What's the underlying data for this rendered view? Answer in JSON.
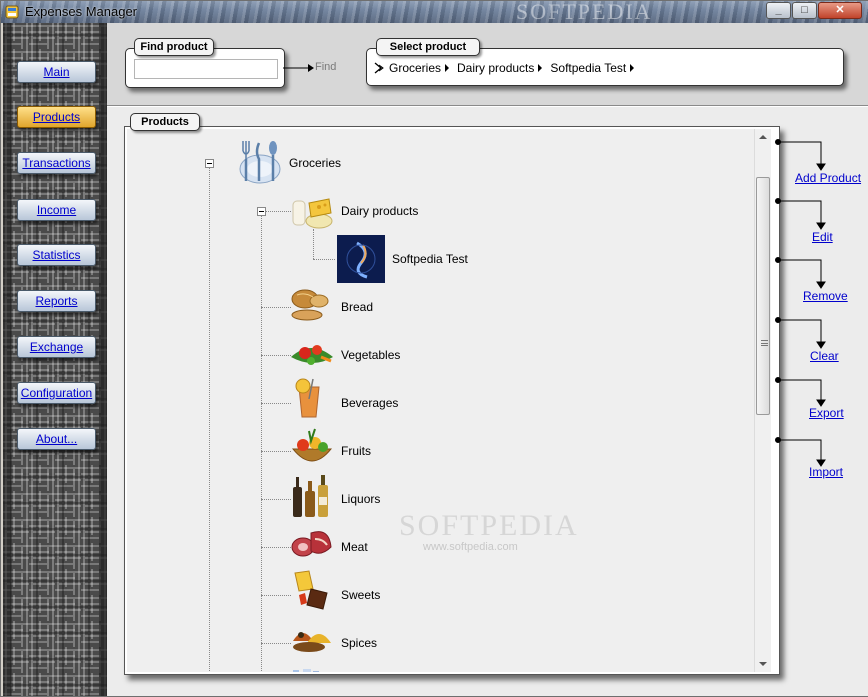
{
  "window": {
    "title": "Expenses Manager",
    "watermark": "SOFTPEDIA",
    "controls": {
      "minimize": "_",
      "maximize": "□",
      "close": "✕"
    }
  },
  "nav": {
    "items": [
      {
        "label": "Main",
        "active": false
      },
      {
        "label": "Products",
        "active": true
      },
      {
        "label": "Transactions",
        "active": false
      },
      {
        "label": "Income",
        "active": false
      },
      {
        "label": "Statistics",
        "active": false
      },
      {
        "label": "Reports",
        "active": false
      },
      {
        "label": "Exchange",
        "active": false
      },
      {
        "label": "Configuration",
        "active": false
      },
      {
        "label": "About...",
        "active": false
      }
    ]
  },
  "find_product": {
    "tab_label": "Find product",
    "input_value": "",
    "find_label": "Find"
  },
  "select_product": {
    "tab_label": "Select product",
    "breadcrumb": [
      "Groceries",
      "Dairy products",
      "Softpedia Test"
    ]
  },
  "products": {
    "tab_label": "Products",
    "watermark": "SOFTPEDIA",
    "watermark_sub": "www.softpedia.com",
    "tree": [
      {
        "label": "Groceries",
        "icon": "cutlery-icon",
        "level": 0,
        "expanded": true
      },
      {
        "label": "Dairy products",
        "icon": "dairy-icon",
        "level": 1,
        "expanded": true
      },
      {
        "label": "Softpedia Test",
        "icon": "softpedia-image-icon",
        "level": 2
      },
      {
        "label": "Bread",
        "icon": "bread-icon",
        "level": 1
      },
      {
        "label": "Vegetables",
        "icon": "vegetables-icon",
        "level": 1
      },
      {
        "label": "Beverages",
        "icon": "beverage-glass-icon",
        "level": 1
      },
      {
        "label": "Fruits",
        "icon": "fruit-basket-icon",
        "level": 1
      },
      {
        "label": "Liquors",
        "icon": "liquor-bottles-icon",
        "level": 1
      },
      {
        "label": "Meat",
        "icon": "meat-icon",
        "level": 1
      },
      {
        "label": "Sweets",
        "icon": "sweets-icon",
        "level": 1
      },
      {
        "label": "Spices",
        "icon": "spices-icon",
        "level": 1
      }
    ]
  },
  "actions": {
    "add_product": "Add Product",
    "edit": "Edit",
    "remove": "Remove",
    "clear": "Clear",
    "export": "Export",
    "import": "Import"
  }
}
